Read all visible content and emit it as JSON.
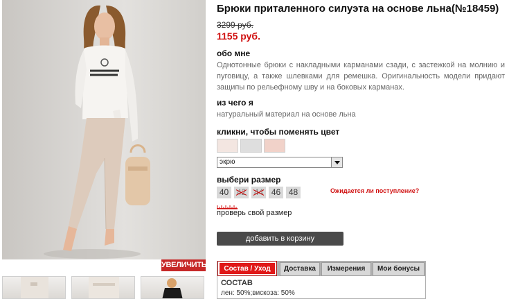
{
  "product": {
    "title": "Брюки приталенного силуэта на основе льна(№18459)",
    "old_price": "3299 руб.",
    "new_price": "1155 руб."
  },
  "about": {
    "heading": "обо мне",
    "text": "Однотонные брюки с накладными карманами сзади, с застежкой на молнию и пуговицу, а также шлевками для ремешка. Оригинальность модели придают защипы по рельефному шву и на боковых карманах."
  },
  "material": {
    "heading": "из чего я",
    "text": "натуральный материал на основе льна"
  },
  "color": {
    "heading": "кликни, чтобы поменять цвет",
    "swatches": [
      {
        "name": "swatch-1",
        "color": "#f3e6e1"
      },
      {
        "name": "swatch-2",
        "color": "#dedede"
      },
      {
        "name": "swatch-3",
        "color": "#f1d2c9"
      }
    ],
    "selected": "экрю"
  },
  "size": {
    "heading": "выбери размер",
    "options": [
      {
        "label": "40",
        "available": true
      },
      {
        "label": "42",
        "available": false
      },
      {
        "label": "44",
        "available": false
      },
      {
        "label": "46",
        "available": true
      },
      {
        "label": "48",
        "available": true
      }
    ],
    "availability_link": "Ожидается ли поступление?",
    "check_size": "проверь свой размер"
  },
  "cart_button": "добавить в корзину",
  "zoom_button": "УВЕЛИЧИТЬ",
  "tabs": [
    "Состав / Уход",
    "Доставка",
    "Измерения",
    "Мои бонусы"
  ],
  "tab_panel": {
    "heading": "СОСТАВ",
    "value": "лен: 50%;вискоза: 50%"
  },
  "colors": {
    "price_red": "#d01010",
    "active_tab": "#e01818",
    "cart_button": "#4a4a4a"
  }
}
